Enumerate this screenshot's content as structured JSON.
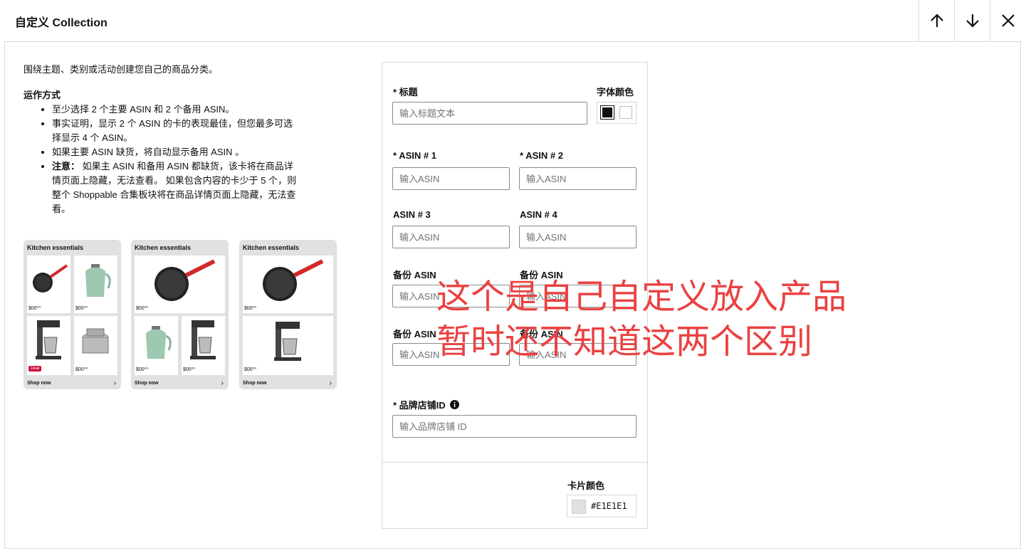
{
  "header": {
    "title": "自定义 Collection",
    "icons": [
      "arrow-up-icon",
      "arrow-down-icon",
      "close-icon"
    ]
  },
  "instructions": {
    "intro": "围绕主题、类别或活动创建您自己的商品分类。",
    "how_title": "运作方式",
    "items": [
      "至少选择 2 个主要 ASIN 和 2 个备用 ASIN。",
      "事实证明，显示 2 个 ASIN 的卡的表现最佳，但您最多可选择显示 4 个 ASIN。",
      "如果主要 ASIN 缺货，将自动显示备用 ASIN 。"
    ],
    "note_label": "注意：",
    "note_text": " 如果主 ASIN 和备用 ASIN 都缺货，该卡将在商品详情页面上隐藏，无法查看。 如果包含内容的卡少于 5 个，则整个 Shoppable 合集板块将在商品详情页面上隐藏，无法查看。"
  },
  "preview_cards": {
    "title": "Kitchen essentials",
    "shop_now": "Shop now",
    "price": "$00⁰⁰",
    "deal": "Deal"
  },
  "form": {
    "title_label": "* 标题",
    "title_placeholder": "输入标题文本",
    "font_color_label": "字体颜色",
    "asin1_label": "* ASIN # 1",
    "asin2_label": "* ASIN # 2",
    "asin3_label": "ASIN # 3",
    "asin4_label": "ASIN # 4",
    "backup1_label": "备份 ASIN",
    "backup2_label": "备份 ASIN",
    "backup3_label": "备份 ASIN",
    "backup4_label": "备份 ASIN",
    "asin_placeholder": "输入ASIN",
    "store_id_label": "* 品牌店铺ID",
    "store_id_placeholder": "输入品牌店铺 ID",
    "card_color_label": "卡片颜色",
    "card_color_value": "#E1E1E1"
  },
  "annotation": {
    "line1": "这个是自己自定义放入产品",
    "line2": "暂时还不知道这两个区别"
  },
  "colors": {
    "border": "#d5d9d9",
    "overlay_red": "#ea4242",
    "card_bg": "#e1e1e1",
    "font_black": "#111111"
  }
}
